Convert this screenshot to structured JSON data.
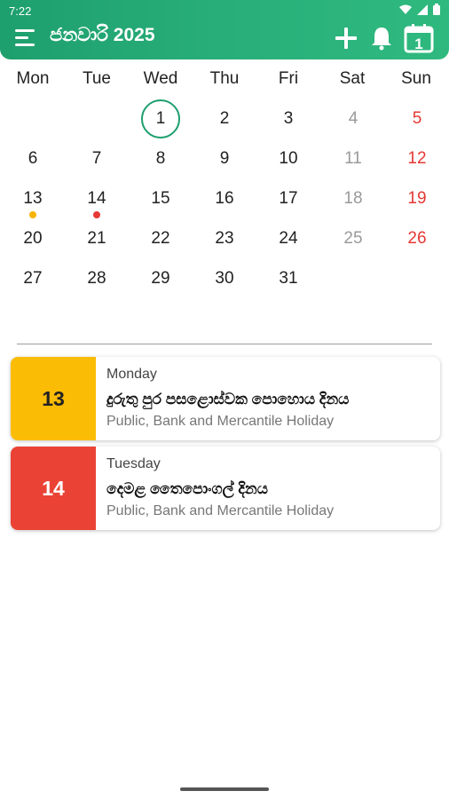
{
  "status_bar": {
    "time": "7:22",
    "icons": [
      "wifi-icon",
      "signal-icon",
      "battery-icon"
    ]
  },
  "header": {
    "title": "ජනවාරි 2025",
    "today_badge": "1",
    "icons": [
      "menu-icon",
      "add-icon",
      "bell-icon",
      "calendar-today-icon"
    ],
    "accent": "#1e9f6e"
  },
  "calendar": {
    "weekdays": [
      "Mon",
      "Tue",
      "Wed",
      "Thu",
      "Fri",
      "Sat",
      "Sun"
    ],
    "weeks": [
      [
        "",
        "",
        "1",
        "2",
        "3",
        "4",
        "5"
      ],
      [
        "6",
        "7",
        "8",
        "9",
        "10",
        "11",
        "12"
      ],
      [
        "13",
        "14",
        "15",
        "16",
        "17",
        "18",
        "19"
      ],
      [
        "20",
        "21",
        "22",
        "23",
        "24",
        "25",
        "26"
      ],
      [
        "27",
        "28",
        "29",
        "30",
        "31",
        "",
        ""
      ]
    ],
    "today": "1",
    "marked_days": [
      {
        "day": "13",
        "color": "#f5b400"
      },
      {
        "day": "14",
        "color": "#e53935"
      }
    ],
    "colors": {
      "weekday": "#222222",
      "saturday": "#9a9a9a",
      "sunday": "#e53935"
    }
  },
  "events": [
    {
      "date": "13",
      "weekday": "Monday",
      "name": "දුරුතු පුර පසළොස්වක පොහොය දිනය",
      "type": "Public, Bank and Mercantile Holiday",
      "color": "#fbbc05",
      "text_color": "#222222"
    },
    {
      "date": "14",
      "weekday": "Tuesday",
      "name": "දෙමළ තෛපොංගල් දිනය",
      "type": "Public, Bank and Mercantile Holiday",
      "color": "#ea4335",
      "text_color": "#ffffff"
    }
  ]
}
